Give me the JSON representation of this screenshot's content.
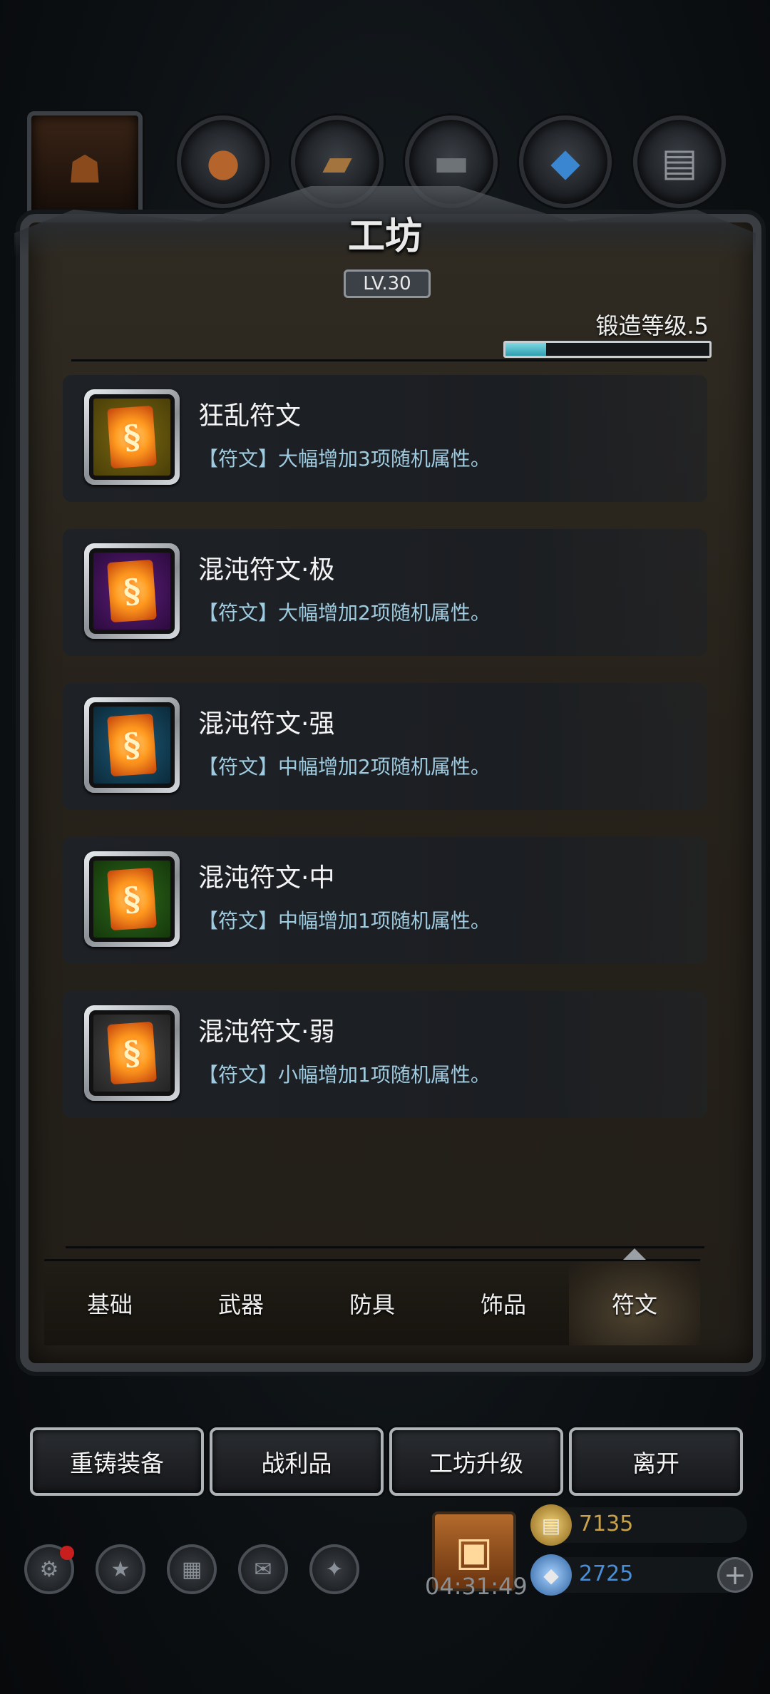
{
  "character_tabs": [
    {
      "icon": "hooded-figure-icon"
    },
    {
      "icon": "pouch-icon"
    },
    {
      "icon": "wood-planks-icon"
    },
    {
      "icon": "iron-ingots-icon"
    },
    {
      "icon": "blue-crystal-icon"
    },
    {
      "icon": "metal-bars-icon"
    }
  ],
  "panel": {
    "title": "工坊",
    "level": "LV.30",
    "forge_level_label": "锻造等级.5",
    "forge_progress": 0.2
  },
  "items": [
    {
      "name": "狂乱符文",
      "desc": "【符文】大幅增加3项随机属性。",
      "quality": "gold"
    },
    {
      "name": "混沌符文·极",
      "desc": "【符文】大幅增加2项随机属性。",
      "quality": "purple"
    },
    {
      "name": "混沌符文·强",
      "desc": "【符文】中幅增加2项随机属性。",
      "quality": "blue"
    },
    {
      "name": "混沌符文·中",
      "desc": "【符文】中幅增加1项随机属性。",
      "quality": "green"
    },
    {
      "name": "混沌符文·弱",
      "desc": "【符文】小幅增加1项随机属性。",
      "quality": "gray"
    }
  ],
  "categories": [
    "基础",
    "武器",
    "防具",
    "饰品",
    "符文"
  ],
  "active_category": "符文",
  "actions": [
    "重铸装备",
    "战利品",
    "工坊升级",
    "离开"
  ],
  "hud": {
    "timer": "04:31:49",
    "gold": "7135",
    "gems": "2725",
    "gold_color": "#c9a14a",
    "gem_color": "#4a8fd6"
  }
}
